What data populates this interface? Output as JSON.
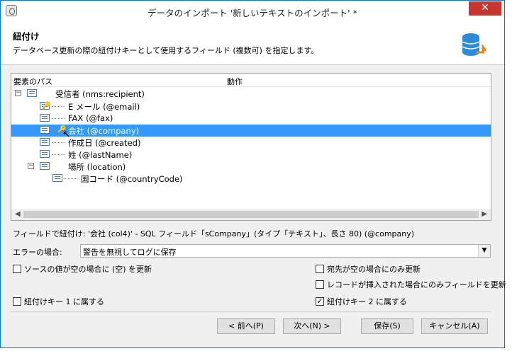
{
  "window": {
    "title": "データのインポート '新しいテキストのインポート' *",
    "close_label": "✕"
  },
  "header": {
    "title": "紐付け",
    "description": "データベース更新の際の紐付けキーとして使用するフィールド (複数可) を指定します。"
  },
  "tree": {
    "columns": [
      "要素のパス",
      "動作"
    ],
    "rows": [
      {
        "label": "受信者 (nms:recipient)",
        "level": 0,
        "expander": "−",
        "key": false,
        "selected": false
      },
      {
        "label": "E メール (@email)",
        "level": 1,
        "key": true,
        "selected": false
      },
      {
        "label": "FAX (@fax)",
        "level": 1,
        "key": false,
        "selected": false
      },
      {
        "label": "会社 (@company)",
        "level": 1,
        "key": true,
        "selected": true
      },
      {
        "label": "作成日 (@created)",
        "level": 1,
        "key": false,
        "selected": false
      },
      {
        "label": "姓 (@lastName)",
        "level": 1,
        "key": false,
        "selected": false
      },
      {
        "label": "場所 (location)",
        "level": 1,
        "expander": "−",
        "key": false,
        "selected": false
      },
      {
        "label": "国コード (@countryCode)",
        "level": 2,
        "key": false,
        "selected": false
      }
    ]
  },
  "info_line": "フィールドで紐付け: '会社 (col4)' - SQL フィールド「sCompany」(タイプ「テキスト」、長さ 80) (@company)",
  "error_field": {
    "label": "エラーの場合:",
    "value": "警告を無視してログに保存"
  },
  "checkboxes": {
    "update_empty_source": {
      "label": "ソースの値が空の場合に (空) を更新",
      "checked": false
    },
    "update_if_dest_empty": {
      "label": "宛先が空の場合にのみ更新",
      "checked": false
    },
    "update_on_insert": {
      "label": "レコードが挿入された場合にのみフィールドを更新",
      "checked": false
    },
    "key1": {
      "label": "紐付けキー 1 に属する",
      "checked": false
    },
    "key2": {
      "label": "紐付けキー 2 に属する",
      "checked": true
    }
  },
  "buttons": {
    "prev": "< 前へ(P)",
    "next": "次へ(N) >",
    "save": "保存(S)",
    "cancel": "キャンセル(A)"
  },
  "colors": {
    "selection": "#3399ff",
    "close": "#c7372f",
    "border": "#0078d7"
  }
}
